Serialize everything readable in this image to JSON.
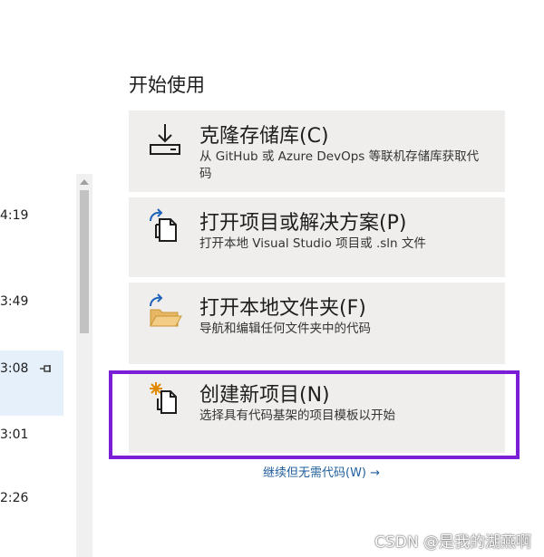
{
  "recent": {
    "items": [
      {
        "time": "4:19",
        "pinned": false,
        "selected": false
      },
      {
        "time": "3:49",
        "pinned": false,
        "selected": false
      },
      {
        "time": "3:08",
        "pinned": true,
        "selected": true
      },
      {
        "time": "3:01",
        "pinned": false,
        "selected": false
      },
      {
        "time": "2:26",
        "pinned": false,
        "selected": false
      }
    ]
  },
  "start": {
    "title": "开始使用",
    "cards": [
      {
        "title": "克隆存储库(C)",
        "desc": "从 GitHub 或 Azure DevOps 等联机存储库获取代码",
        "icon": "clone-icon"
      },
      {
        "title": "打开项目或解决方案(P)",
        "desc": "打开本地 Visual Studio 项目或 .sln 文件",
        "icon": "open-project-icon"
      },
      {
        "title": "打开本地文件夹(F)",
        "desc": "导航和编辑任何文件夹中的代码",
        "icon": "open-folder-icon"
      },
      {
        "title": "创建新项目(N)",
        "desc": "选择具有代码基架的项目模板以开始",
        "icon": "new-project-icon"
      }
    ],
    "continue_link": "继续但无需代码(W) →"
  },
  "watermark": "CSDN @是我的湖燕啊",
  "colors": {
    "highlight": "#7a1fd6",
    "card_bg": "#efeeec",
    "link": "#1f5e9c",
    "selected_row": "#e6f0fb"
  }
}
